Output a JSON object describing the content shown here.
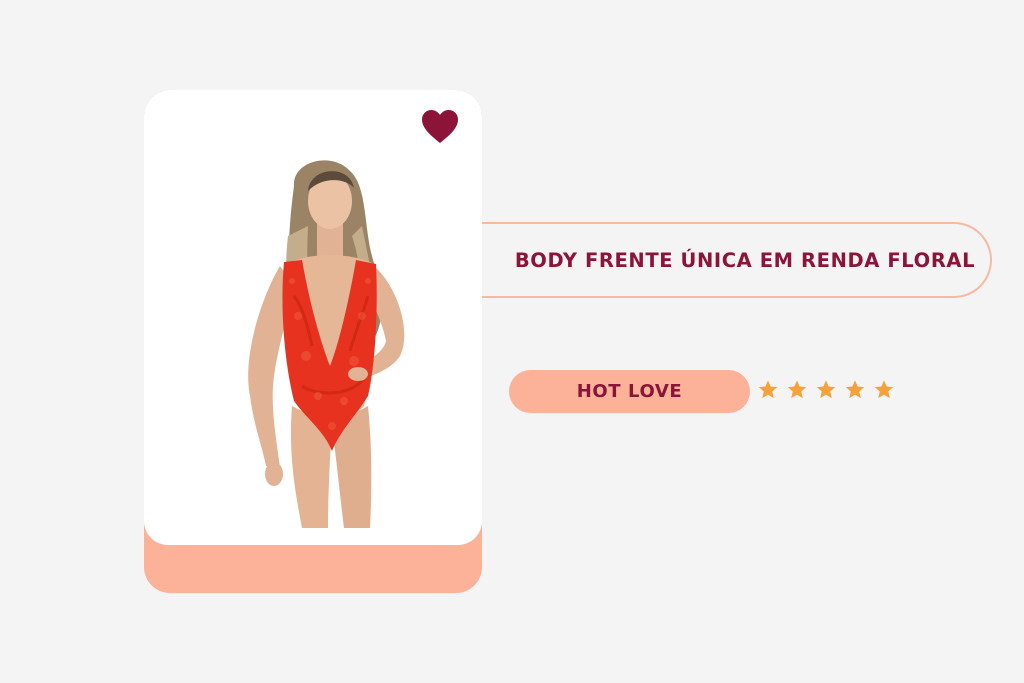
{
  "product": {
    "title": "BODY FRENTE ÚNICA EM RENDA FLORAL",
    "brand": "HOT LOVE",
    "rating": 5,
    "rating_max": 5,
    "image_alt": "Modelo vestindo body vermelho de renda floral",
    "favorite_icon": "heart-icon",
    "star_icon": "star-icon"
  },
  "colors": {
    "background": "#f4f4f4",
    "accent_peach": "#fcb298",
    "text_maroon": "#8d1439",
    "heart": "#8d1439",
    "star": "#f7a13a"
  }
}
